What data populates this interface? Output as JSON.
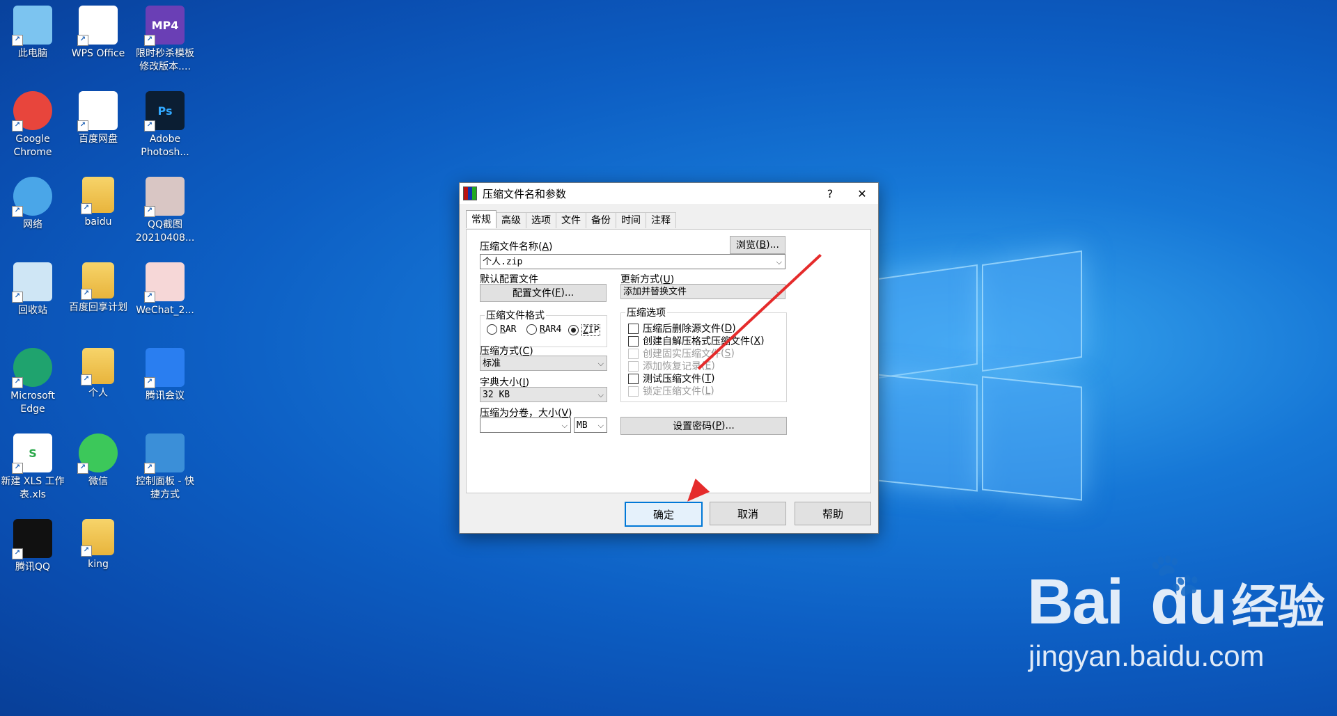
{
  "desktop": {
    "icons": [
      {
        "label": "此电脑",
        "icon": "computer-icon"
      },
      {
        "label": "WPS Office",
        "icon": "wps-icon"
      },
      {
        "label": "限时秒杀模板修改版本....",
        "icon": "mp4-file-icon",
        "badge": "MP4"
      },
      {
        "label": "Google Chrome",
        "icon": "chrome-icon"
      },
      {
        "label": "百度网盘",
        "icon": "baidu-netdisk-icon"
      },
      {
        "label": "Adobe Photosh...",
        "icon": "photoshop-icon",
        "badge": "Ps"
      },
      {
        "label": "网络",
        "icon": "network-icon"
      },
      {
        "label": "baidu",
        "icon": "folder-icon"
      },
      {
        "label": "QQ截图20210408...",
        "icon": "image-file-icon"
      },
      {
        "label": "回收站",
        "icon": "recycle-bin-icon"
      },
      {
        "label": "百度回享计划",
        "icon": "folder-icon"
      },
      {
        "label": "WeChat_2...",
        "icon": "video-file-icon"
      },
      {
        "label": "Microsoft Edge",
        "icon": "edge-icon"
      },
      {
        "label": "个人",
        "icon": "folder-icon"
      },
      {
        "label": "腾讯会议",
        "icon": "tencent-meeting-icon"
      },
      {
        "label": "新建 XLS 工作表.xls",
        "icon": "xls-file-icon",
        "badge": "S"
      },
      {
        "label": "微信",
        "icon": "wechat-icon"
      },
      {
        "label": "控制面板 - 快捷方式",
        "icon": "control-panel-icon"
      },
      {
        "label": "腾讯QQ",
        "icon": "qq-icon"
      },
      {
        "label": "king",
        "icon": "folder-icon"
      }
    ]
  },
  "dialog": {
    "title": "压缩文件名和参数",
    "help_btn": "?",
    "close_btn": "✕",
    "tabs": [
      "常规",
      "高级",
      "选项",
      "文件",
      "备份",
      "时间",
      "注释"
    ],
    "archive_name_label": "压缩文件名称",
    "archive_name_hotkey": "A",
    "browse_label": "浏览",
    "browse_hotkey": "B",
    "archive_name_value": "个人.zip",
    "profile_label": "默认配置文件",
    "profile_btn": "配置文件",
    "profile_hotkey": "F",
    "update_label": "更新方式",
    "update_hotkey": "U",
    "update_value": "添加并替换文件",
    "format_group": "压缩文件格式",
    "formats": [
      {
        "label": "RAR",
        "hot": "R",
        "rest": "AR",
        "checked": false
      },
      {
        "label": "RAR4",
        "hot": "R",
        "rest": "AR4",
        "checked": false
      },
      {
        "label": "ZIP",
        "hot": "Z",
        "rest": "IP",
        "checked": true
      }
    ],
    "method_label": "压缩方式",
    "method_hotkey": "C",
    "method_value": "标准",
    "dict_label": "字典大小",
    "dict_hotkey": "I",
    "dict_value": "32 KB",
    "split_label": "压缩为分卷，大小",
    "split_hotkey": "V",
    "split_value": "",
    "split_unit": "MB",
    "options_group": "压缩选项",
    "options": [
      {
        "label": "压缩后删除源文件",
        "hotkey": "D",
        "enabled": true
      },
      {
        "label": "创建自解压格式压缩文件",
        "hotkey": "X",
        "enabled": true
      },
      {
        "label": "创建固实压缩文件",
        "hotkey": "S",
        "enabled": false
      },
      {
        "label": "添加恢复记录",
        "hotkey": "E",
        "enabled": false
      },
      {
        "label": "测试压缩文件",
        "hotkey": "T",
        "enabled": true
      },
      {
        "label": "锁定压缩文件",
        "hotkey": "L",
        "enabled": false
      }
    ],
    "password_btn": "设置密码",
    "password_hotkey": "P",
    "ok": "确定",
    "cancel": "取消",
    "help": "帮助"
  },
  "watermark": {
    "brand": "Bai",
    "brand2": "du",
    "cn": "经验",
    "url": "jingyan.baidu.com"
  },
  "colors": {
    "accent": "#0078d7",
    "arrow": "#e52b2b"
  }
}
